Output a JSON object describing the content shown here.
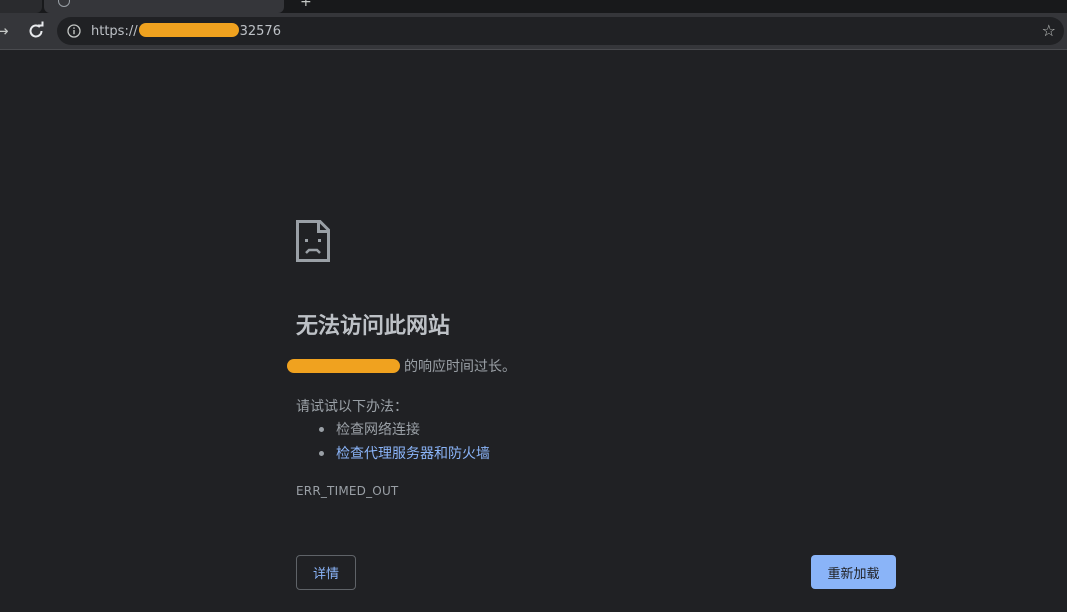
{
  "browser": {
    "new_tab_symbol": "+",
    "forward_symbol": "→",
    "url_prefix": "https://",
    "url_suffix": "32576",
    "star_symbol": "☆"
  },
  "error_page": {
    "title": "无法访问此网站",
    "summary_suffix": "的响应时间过长。",
    "suggestions_title": "请试试以下办法：",
    "suggestions": [
      {
        "text": "检查网络连接",
        "is_link": false
      },
      {
        "text": "检查代理服务器和防火墙",
        "is_link": true
      }
    ],
    "error_code": "ERR_TIMED_OUT",
    "details_button": "详情",
    "reload_button": "重新加载"
  },
  "colors": {
    "background": "#202124",
    "link": "#8ab4f8",
    "redaction": "#f0a21f"
  }
}
